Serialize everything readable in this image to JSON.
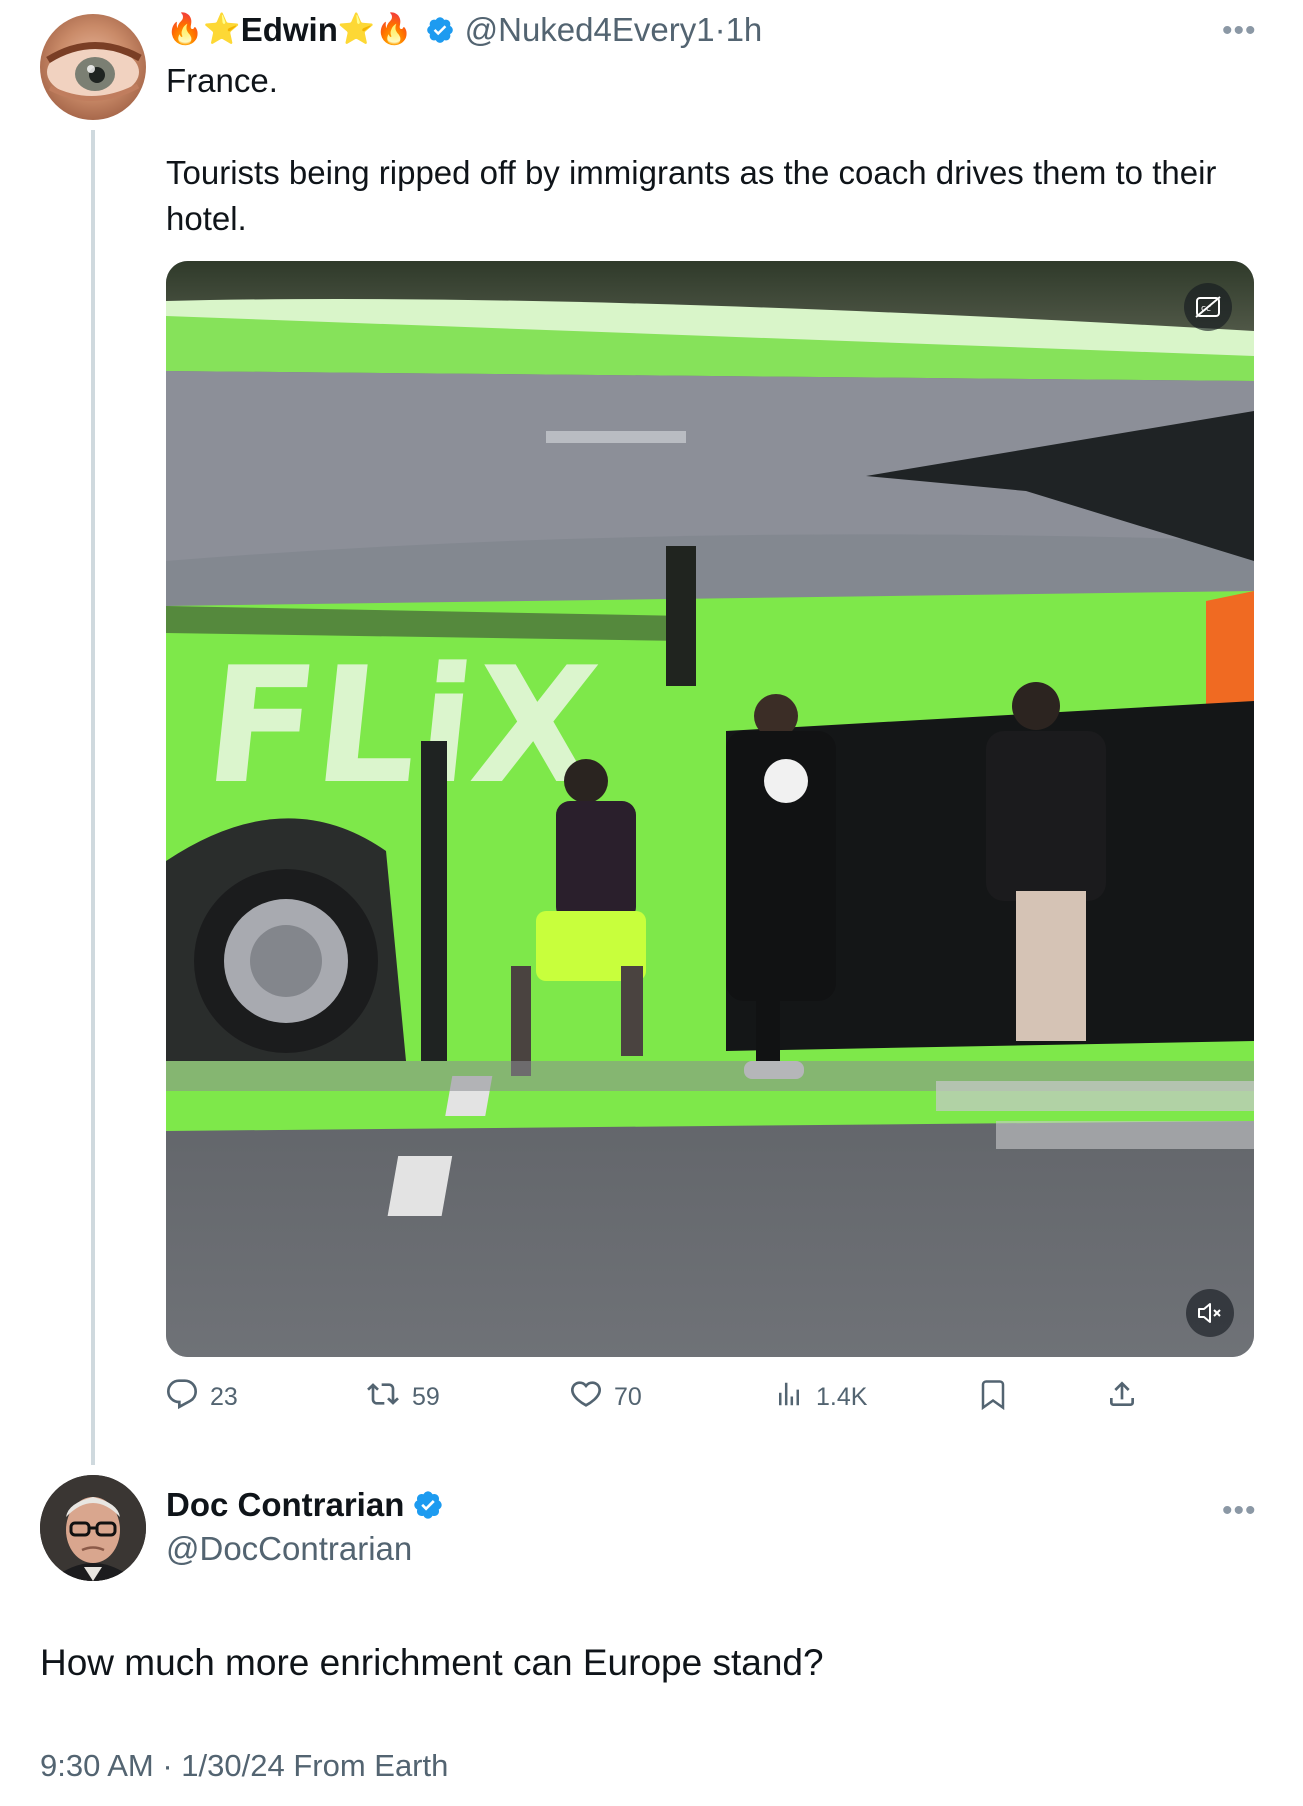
{
  "tweet1": {
    "name": "Edwin",
    "name_prefix_emoji": [
      "fire",
      "star"
    ],
    "name_suffix_emoji": [
      "star",
      "fire"
    ],
    "verified": true,
    "handle": "@Nuked4Every1",
    "separator": "·",
    "time": "1h",
    "text_line1": "France.",
    "text_line2": "Tourists being ripped off by immigrants as the coach drives them to their hotel.",
    "media": {
      "type": "video",
      "bus_text": "FLiX",
      "controls": [
        "captions-off-icon",
        "mute-icon"
      ]
    },
    "actions": {
      "replies": "23",
      "reposts": "59",
      "likes": "70",
      "views": "1.4K"
    }
  },
  "tweet2": {
    "name": "Doc Contrarian",
    "verified": true,
    "handle": "@DocContrarian",
    "text": "How much more enrichment can Europe stand?",
    "meta": "9:30 AM · 1/30/24 From Earth"
  },
  "colors": {
    "verified_blue": "#1d9bf0",
    "secondary_text": "#536471",
    "thread_line": "#cfd9de",
    "bus_green": "#7ee84a"
  }
}
